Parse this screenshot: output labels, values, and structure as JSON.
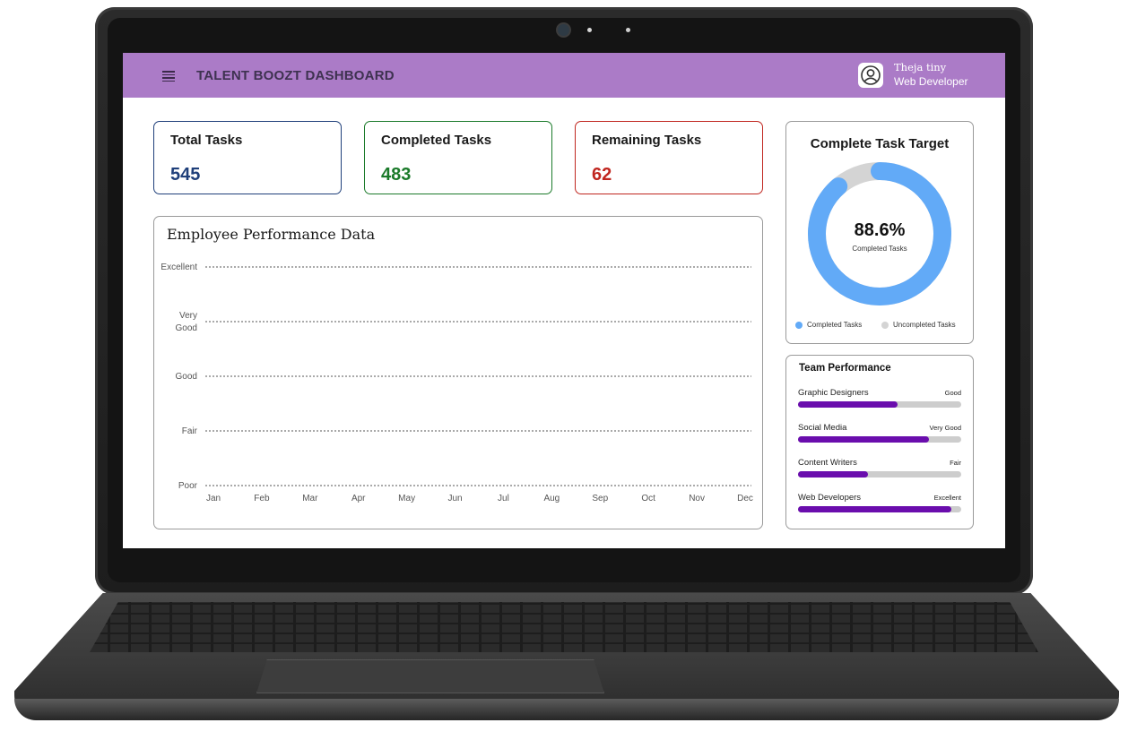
{
  "header": {
    "app_title": "TALENT BOOZT DASHBOARD",
    "user_name": "Theja tiny",
    "user_role": "Web Developer"
  },
  "stats": [
    {
      "label": "Total Tasks",
      "value": "545",
      "color": "#1f3f7a"
    },
    {
      "label": "Completed Tasks",
      "value": "483",
      "color": "#1b7a2a"
    },
    {
      "label": "Remaining Tasks",
      "value": "62",
      "color": "#c0261f"
    }
  ],
  "performance_chart": {
    "title": "Employee Performance Data"
  },
  "chart_data": {
    "type": "line",
    "title": "Employee Performance Data",
    "categories": [
      "Jan",
      "Feb",
      "Mar",
      "Apr",
      "May",
      "Jun",
      "Jul",
      "Aug",
      "Sep",
      "Oct",
      "Nov",
      "Dec"
    ],
    "y_levels": [
      "Excellent",
      "Very Good",
      "Good",
      "Fair",
      "Poor"
    ],
    "series": [],
    "grid": true
  },
  "task_target": {
    "title": "Complete Task Target",
    "percent_label": "88.6%",
    "sub_label": "Completed Tasks",
    "completed_fraction": 0.886,
    "completed_color": "#62aaf7",
    "uncompleted_color": "#d4d4d4",
    "legend": [
      "Completed Tasks",
      "Uncompleted Tasks"
    ]
  },
  "team": {
    "title": "Team Performance",
    "rows": [
      {
        "name": "Graphic Designers",
        "level": "Good",
        "fraction": 0.61
      },
      {
        "name": "Social Media",
        "level": "Very Good",
        "fraction": 0.8
      },
      {
        "name": "Content Writers",
        "level": "Fair",
        "fraction": 0.43
      },
      {
        "name": "Web Developers",
        "level": "Excellent",
        "fraction": 0.94
      }
    ]
  }
}
